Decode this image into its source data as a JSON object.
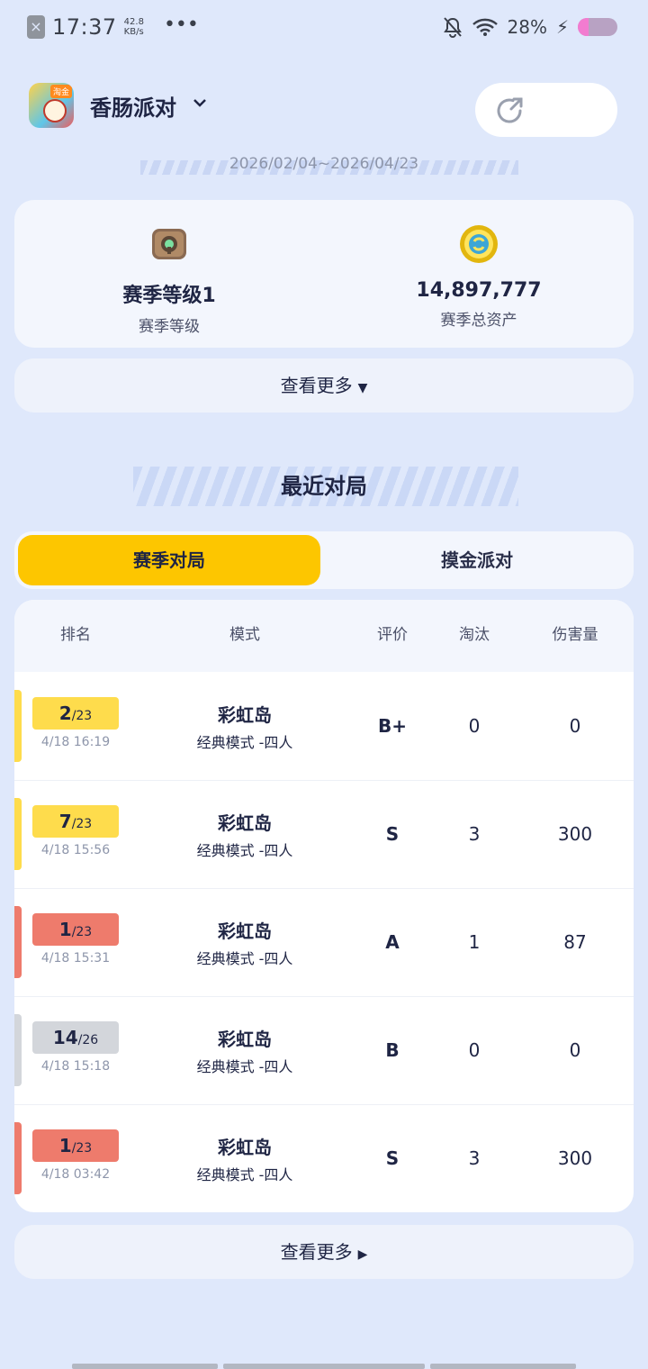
{
  "status_bar": {
    "time": "17:37",
    "speed_value": "42.8",
    "speed_unit": "KB/s",
    "more": "•••",
    "battery_text": "28%",
    "battery_level": 0.28
  },
  "header": {
    "app_title": "香肠派对",
    "app_badge": "淘金"
  },
  "season": {
    "date_range": "2026/02/04~2026/04/23"
  },
  "stats": [
    {
      "value": "赛季等级1",
      "label": "赛季等级",
      "icon": "chest-icon"
    },
    {
      "value": "14,897,777",
      "label": "赛季总资产",
      "icon": "coin-icon"
    }
  ],
  "more_label": "查看更多",
  "recent": {
    "title": "最近对局",
    "tabs": [
      "赛季对局",
      "摸金派对"
    ],
    "columns": [
      "排名",
      "模式",
      "评价",
      "淘汰",
      "伤害量"
    ],
    "rows": [
      {
        "rank": "2",
        "total": "/23",
        "time": "4/18 16:19",
        "map": "彩虹岛",
        "mode": "经典模式 -四人",
        "grade": "B+",
        "kills": "0",
        "damage": "0",
        "color": "#fedc4c"
      },
      {
        "rank": "7",
        "total": "/23",
        "time": "4/18 15:56",
        "map": "彩虹岛",
        "mode": "经典模式 -四人",
        "grade": "S",
        "kills": "3",
        "damage": "300",
        "color": "#fedc4c"
      },
      {
        "rank": "1",
        "total": "/23",
        "time": "4/18 15:31",
        "map": "彩虹岛",
        "mode": "经典模式 -四人",
        "grade": "A",
        "kills": "1",
        "damage": "87",
        "color": "#ee7b6c"
      },
      {
        "rank": "14",
        "total": "/26",
        "time": "4/18 15:18",
        "map": "彩虹岛",
        "mode": "经典模式 -四人",
        "grade": "B",
        "kills": "0",
        "damage": "0",
        "color": "#d3d6db"
      },
      {
        "rank": "1",
        "total": "/23",
        "time": "4/18 03:42",
        "map": "彩虹岛",
        "mode": "经典模式 -四人",
        "grade": "S",
        "kills": "3",
        "damage": "300",
        "color": "#ee7b6c"
      }
    ]
  },
  "colors": {
    "background": "#dfe8fb",
    "active_tab": "#fdc600",
    "rank_yellow": "#fedc4c",
    "rank_red": "#ee7b6c",
    "rank_gray": "#d3d6db"
  }
}
